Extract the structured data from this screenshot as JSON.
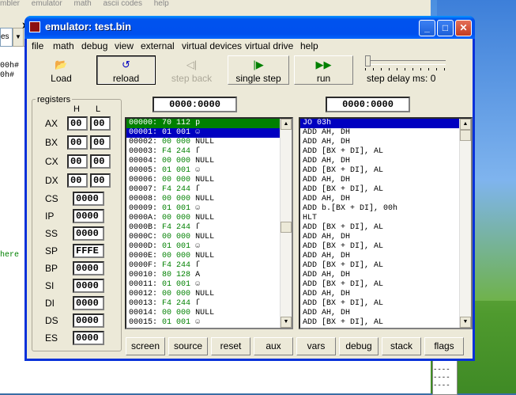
{
  "background_editor": {
    "menu": [
      "mbler",
      "emulator",
      "math",
      "ascii codes",
      "help"
    ],
    "toolbar_btn_label": "es",
    "code_lines": [
      "00h#",
      "0h#"
    ],
    "side_text": "here",
    "right_list": [
      "----",
      "----",
      "----"
    ]
  },
  "window": {
    "title": "emulator: test.bin",
    "menu": [
      "file",
      "math",
      "debug",
      "view",
      "external",
      "virtual devices",
      "virtual drive",
      "help"
    ]
  },
  "toolbar": {
    "load": "Load",
    "reload": "reload",
    "step_back": "step back",
    "single_step": "single step",
    "run": "run",
    "step_delay": "step delay ms: 0"
  },
  "registers": {
    "title": "registers",
    "h_label": "H",
    "l_label": "L",
    "byte_regs": [
      {
        "name": "AX",
        "h": "00",
        "l": "00"
      },
      {
        "name": "BX",
        "h": "00",
        "l": "00"
      },
      {
        "name": "CX",
        "h": "00",
        "l": "00"
      },
      {
        "name": "DX",
        "h": "00",
        "l": "00"
      }
    ],
    "word_regs": [
      {
        "name": "CS",
        "value": "0000"
      },
      {
        "name": "IP",
        "value": "0000"
      },
      {
        "name": "SS",
        "value": "0000"
      },
      {
        "name": "SP",
        "value": "FFFE"
      },
      {
        "name": "BP",
        "value": "0000"
      },
      {
        "name": "SI",
        "value": "0000"
      },
      {
        "name": "DI",
        "value": "0000"
      },
      {
        "name": "DS",
        "value": "0000"
      },
      {
        "name": "ES",
        "value": "0000"
      }
    ]
  },
  "memory_address": "0000:0000",
  "disasm_address": "0000:0000",
  "memory_rows": [
    {
      "addr": "00000:",
      "hex": "70 112",
      "ch": "p"
    },
    {
      "addr": "00001:",
      "hex": "01 001",
      "ch": "☺"
    },
    {
      "addr": "00002:",
      "hex": "00 000",
      "ch": "NULL"
    },
    {
      "addr": "00003:",
      "hex": "F4 244",
      "ch": "ſ"
    },
    {
      "addr": "00004:",
      "hex": "00 000",
      "ch": "NULL"
    },
    {
      "addr": "00005:",
      "hex": "01 001",
      "ch": "☺"
    },
    {
      "addr": "00006:",
      "hex": "00 000",
      "ch": "NULL"
    },
    {
      "addr": "00007:",
      "hex": "F4 244",
      "ch": "ſ"
    },
    {
      "addr": "00008:",
      "hex": "00 000",
      "ch": "NULL"
    },
    {
      "addr": "00009:",
      "hex": "01 001",
      "ch": "☺"
    },
    {
      "addr": "0000A:",
      "hex": "00 000",
      "ch": "NULL"
    },
    {
      "addr": "0000B:",
      "hex": "F4 244",
      "ch": "ſ"
    },
    {
      "addr": "0000C:",
      "hex": "00 000",
      "ch": "NULL"
    },
    {
      "addr": "0000D:",
      "hex": "01 001",
      "ch": "☺"
    },
    {
      "addr": "0000E:",
      "hex": "00 000",
      "ch": "NULL"
    },
    {
      "addr": "0000F:",
      "hex": "F4 244",
      "ch": "ſ"
    },
    {
      "addr": "00010:",
      "hex": "80 128",
      "ch": "A"
    },
    {
      "addr": "00011:",
      "hex": "01 001",
      "ch": "☺"
    },
    {
      "addr": "00012:",
      "hex": "00 000",
      "ch": "NULL"
    },
    {
      "addr": "00013:",
      "hex": "F4 244",
      "ch": "ſ"
    },
    {
      "addr": "00014:",
      "hex": "00 000",
      "ch": "NULL"
    },
    {
      "addr": "00015:",
      "hex": "01 001",
      "ch": "☺"
    }
  ],
  "disasm_rows": [
    "JO 03h",
    "ADD AH, DH",
    "ADD AH, DH",
    "ADD [BX + DI], AL",
    "ADD AH, DH",
    "ADD [BX + DI], AL",
    "ADD AH, DH",
    "ADD [BX + DI], AL",
    "ADD AH, DH",
    "ADD b.[BX + DI], 00h",
    "HLT",
    "ADD [BX + DI], AL",
    "ADD AH, DH",
    "ADD [BX + DI], AL",
    "ADD AH, DH",
    "ADD [BX + DI], AL",
    "ADD AH, DH",
    "ADD [BX + DI], AL",
    "ADD AH, DH",
    "ADD [BX + DI], AL",
    "ADD AH, DH",
    "ADD [BX + DI], AL",
    "..."
  ],
  "bottom_buttons": [
    "screen",
    "source",
    "reset",
    "aux",
    "vars",
    "debug",
    "stack",
    "flags"
  ]
}
